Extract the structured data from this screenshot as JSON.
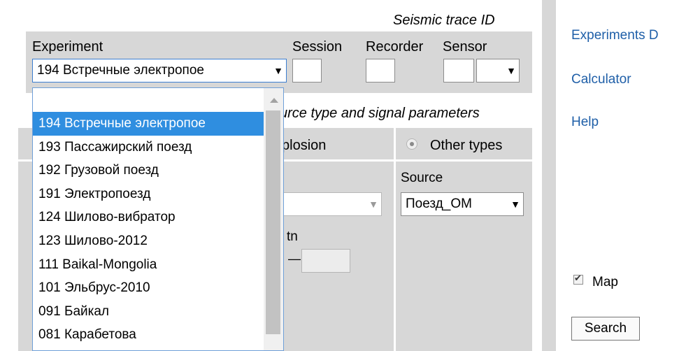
{
  "header": {
    "seismic_trace_id": "Seismic trace ID"
  },
  "trace_id": {
    "experiment_label": "Experiment",
    "session_label": "Session",
    "recorder_label": "Recorder",
    "sensor_label": "Sensor",
    "experiment_selected": "194 Встречные электропое",
    "experiment_options": [
      "194 Встречные электропое",
      "193 Пассажирский поезд",
      "192 Грузовой поезд",
      "191 Электропоезд",
      "124 Шилово-вибратор",
      "123 Шилово-2012",
      "111 Baikal-Mongolia",
      "101 Эльбрус-2010",
      "091 Байкал",
      "081 Карабетова"
    ]
  },
  "source": {
    "section_title": "urce type and signal parameters",
    "explosion_fragment": "plosion",
    "other_types_label": "Other types",
    "source_label": "Source",
    "source_selected": "Поезд_ОМ",
    "tn_label": "tn",
    "dash": "—"
  },
  "sidebar": {
    "links": [
      "Experiments D",
      "Calculator",
      "Help"
    ],
    "map_label": "Map",
    "map_checked": true,
    "search_label": "Search"
  },
  "icons": {
    "dropdown": "▼",
    "checkmark": "✔"
  }
}
